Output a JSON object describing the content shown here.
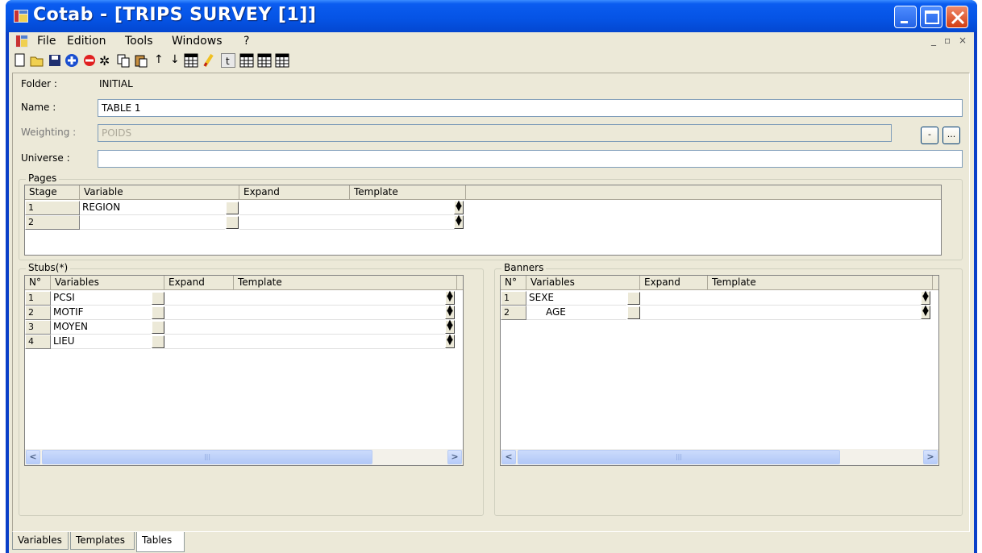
{
  "window": {
    "title": "Cotab - [TRIPS SURVEY [1]]"
  },
  "menu": {
    "items": [
      "File",
      "Edition",
      "Tools",
      "Windows",
      "?"
    ]
  },
  "toolbar": {
    "icons": [
      "new-icon",
      "open-icon",
      "save-icon",
      "add-icon",
      "remove-icon",
      "cut-icon",
      "copy-icon",
      "paste-icon",
      "move-up-icon",
      "move-down-icon",
      "table-icon",
      "edit-icon",
      "text-icon",
      "table-run-icon",
      "table-export-icon",
      "table-print-icon"
    ]
  },
  "form": {
    "folder_label": "Folder :",
    "folder_value": "INITIAL",
    "name_label": "Name :",
    "name_value": "TABLE 1",
    "weighting_label": "Weighting :",
    "weighting_value": "POIDS",
    "weighting_btn1": "-",
    "weighting_btn2": "...",
    "universe_label": "Universe :",
    "universe_value": ""
  },
  "pages": {
    "title": "Pages",
    "headers": [
      "Stage",
      "Variable",
      "Expand",
      "Template"
    ],
    "rows": [
      {
        "n": "1",
        "variable": "REGION"
      },
      {
        "n": "2",
        "variable": ""
      }
    ]
  },
  "stubs": {
    "title": "Stubs(*)",
    "headers": [
      "N°",
      "Variables",
      "Expand",
      "Template"
    ],
    "rows": [
      {
        "n": "1",
        "variable": "PCSI"
      },
      {
        "n": "2",
        "variable": "MOTIF"
      },
      {
        "n": "3",
        "variable": "MOYEN"
      },
      {
        "n": "4",
        "variable": "LIEU"
      }
    ]
  },
  "banners": {
    "title": "Banners",
    "headers": [
      "N°",
      "Variables",
      "Expand",
      "Template"
    ],
    "rows": [
      {
        "n": "1",
        "variable": "SEXE"
      },
      {
        "n": "2",
        "variable": "AGE"
      }
    ]
  },
  "tabs": [
    "Variables",
    "Templates",
    "Tables"
  ],
  "active_tab": "Tables"
}
